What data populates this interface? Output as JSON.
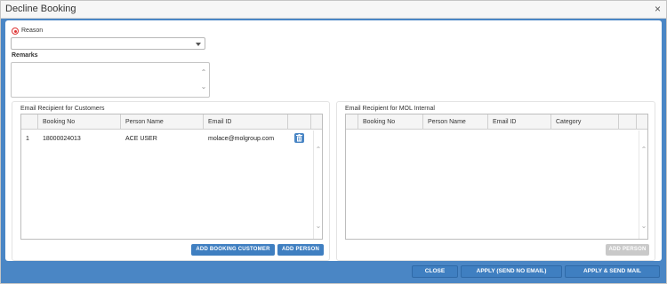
{
  "dialog": {
    "title": "Decline Booking",
    "close_glyph": "×"
  },
  "form": {
    "reason_label": "Reason",
    "reason_value": "",
    "remarks_label": "Remarks",
    "remarks_value": ""
  },
  "customers": {
    "title": "Email Recipient for Customers",
    "columns": [
      "Booking No",
      "Person Name",
      "Email ID"
    ],
    "rows": [
      {
        "index": "1",
        "booking_no": "18000024013",
        "person_name": "ACE USER",
        "email": "molace@molgroup.com"
      }
    ],
    "add_booking_customer": "ADD BOOKING CUSTOMER",
    "add_person": "ADD PERSON"
  },
  "internal": {
    "title": "Email Recipient for MOL Internal",
    "columns": [
      "Booking No",
      "Person Name",
      "Email ID",
      "Category"
    ],
    "add_person": "ADD PERSON"
  },
  "footer": {
    "close": "CLOSE",
    "apply_no_email": "APPLY (SEND NO EMAIL)",
    "apply_send_mail": "APPLY & SEND MAIL"
  },
  "icons": {
    "required": "required-radio-icon",
    "trash": "trash-icon",
    "caret": "chevron-down-icon"
  },
  "colors": {
    "accent": "#3f7fc1",
    "frame": "#4a86c5",
    "required": "#dd3333",
    "disabled": "#c9c9c9"
  }
}
